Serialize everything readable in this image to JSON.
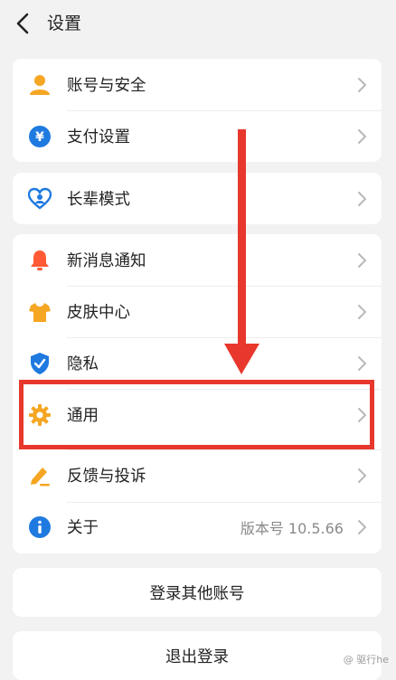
{
  "header": {
    "title": "设置"
  },
  "groups": [
    {
      "items": [
        {
          "label": "账号与安全",
          "icon": "user-icon"
        },
        {
          "label": "支付设置",
          "icon": "yuan-icon"
        }
      ]
    },
    {
      "items": [
        {
          "label": "长辈模式",
          "icon": "heart-person-icon"
        }
      ]
    },
    {
      "items": [
        {
          "label": "新消息通知",
          "icon": "bell-icon"
        },
        {
          "label": "皮肤中心",
          "icon": "tshirt-icon"
        },
        {
          "label": "隐私",
          "icon": "shield-check-icon"
        },
        {
          "label": "通用",
          "icon": "gear-icon"
        },
        {
          "label": "反馈与投诉",
          "icon": "edit-icon"
        },
        {
          "label": "关于",
          "icon": "info-icon",
          "value": "版本号 10.5.66"
        }
      ]
    }
  ],
  "buttons": {
    "login_other": "登录其他账号",
    "logout": "退出登录"
  },
  "watermark": "@ 驱行he",
  "colors": {
    "orange": "#f5a623",
    "blue": "#1f7ae0",
    "highlight": "#e8372c"
  }
}
